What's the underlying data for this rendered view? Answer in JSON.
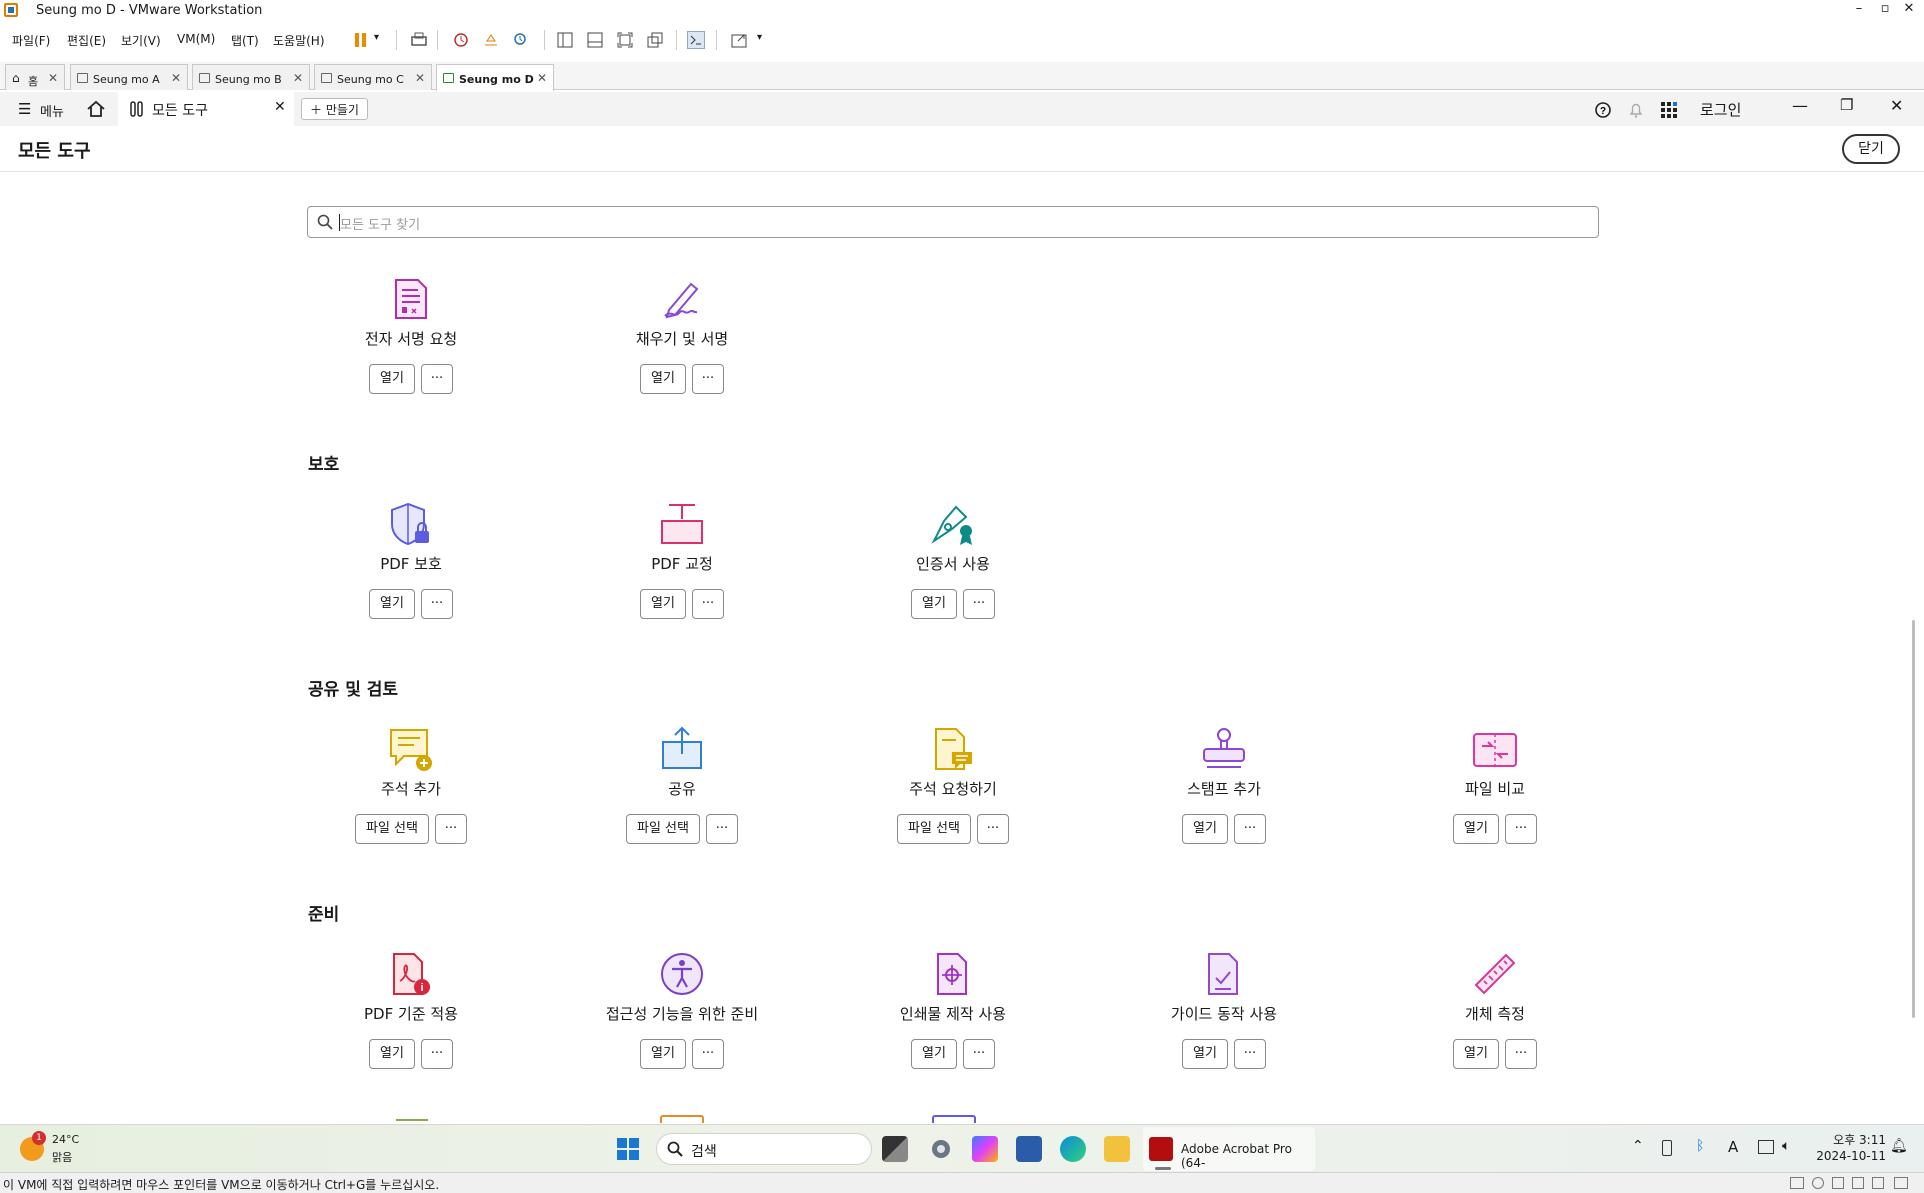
{
  "vmware": {
    "title": "Seung mo D - VMware Workstation",
    "menu": [
      "파일(F)",
      "편집(E)",
      "보기(V)",
      "VM(M)",
      "탭(T)",
      "도움말(H)"
    ],
    "tabs": [
      {
        "label": "홈"
      },
      {
        "label": "Seung mo A"
      },
      {
        "label": "Seung mo B"
      },
      {
        "label": "Seung mo C"
      },
      {
        "label": "Seung mo D"
      }
    ],
    "status_text": "이 VM에 직접 입력하려면 마우스 포인터를 VM으로 이동하거나 Ctrl+G를 누르십시오."
  },
  "acrobat": {
    "menu_label": "메뉴",
    "active_tab": "모든 도구",
    "create_label": "만들기",
    "login_label": "로그인",
    "page_title": "모든 도구",
    "close_label": "닫기",
    "search_placeholder": "모든 도구 찾기",
    "top_tools": [
      {
        "label": "전자 서명 요청",
        "btn": "열기",
        "icon": "request-signature-icon"
      },
      {
        "label": "채우기 및 서명",
        "btn": "열기",
        "icon": "fill-sign-icon"
      }
    ],
    "sections": [
      {
        "title": "보호",
        "tools": [
          {
            "label": "PDF 보호",
            "btn": "열기",
            "icon": "protect-pdf-icon"
          },
          {
            "label": "PDF 교정",
            "btn": "열기",
            "icon": "redact-pdf-icon"
          },
          {
            "label": "인증서 사용",
            "btn": "열기",
            "icon": "certificate-icon"
          }
        ]
      },
      {
        "title": "공유 및 검토",
        "tools": [
          {
            "label": "주석 추가",
            "btn": "파일 선택",
            "icon": "add-comment-icon"
          },
          {
            "label": "공유",
            "btn": "파일 선택",
            "icon": "share-icon"
          },
          {
            "label": "주석 요청하기",
            "btn": "파일 선택",
            "icon": "request-comment-icon"
          },
          {
            "label": "스탬프 추가",
            "btn": "열기",
            "icon": "stamp-icon"
          },
          {
            "label": "파일 비교",
            "btn": "열기",
            "icon": "compare-files-icon"
          }
        ]
      },
      {
        "title": "준비",
        "tools": [
          {
            "label": "PDF 기준 적용",
            "btn": "열기",
            "icon": "pdf-standards-icon"
          },
          {
            "label": "접근성 기능을 위한 준비",
            "btn": "열기",
            "icon": "accessibility-icon"
          },
          {
            "label": "인쇄물 제작 사용",
            "btn": "열기",
            "icon": "print-production-icon"
          },
          {
            "label": "가이드 동작 사용",
            "btn": "열기",
            "icon": "guided-action-icon"
          },
          {
            "label": "개체 측정",
            "btn": "열기",
            "icon": "measure-icon"
          }
        ]
      }
    ],
    "more_label": "···"
  },
  "taskbar": {
    "weather_temp": "24°C",
    "weather_desc": "맑음",
    "weather_badge": "1",
    "search_label": "검색",
    "acrobat_task": "Adobe Acrobat Pro (64-",
    "time": "오후 3:11",
    "date": "2024-10-11",
    "ime": "A"
  },
  "colors": {
    "accent_blue": "#1473e6",
    "sign_purple": "#b12cb1",
    "protect_blue": "#5c5ce0",
    "redact_pink": "#d9306f",
    "cert_teal": "#0f8a8a",
    "comment_gold": "#d4a600",
    "share_blue": "#2f7fd6",
    "stamp_purple": "#8b47d6",
    "compare_pink": "#e0349c",
    "standards_red": "#d7263d",
    "access_purple": "#7b3fc9",
    "print_purple": "#a133c7",
    "guided_purple": "#9447d2",
    "measure_pink": "#d13a9a"
  }
}
